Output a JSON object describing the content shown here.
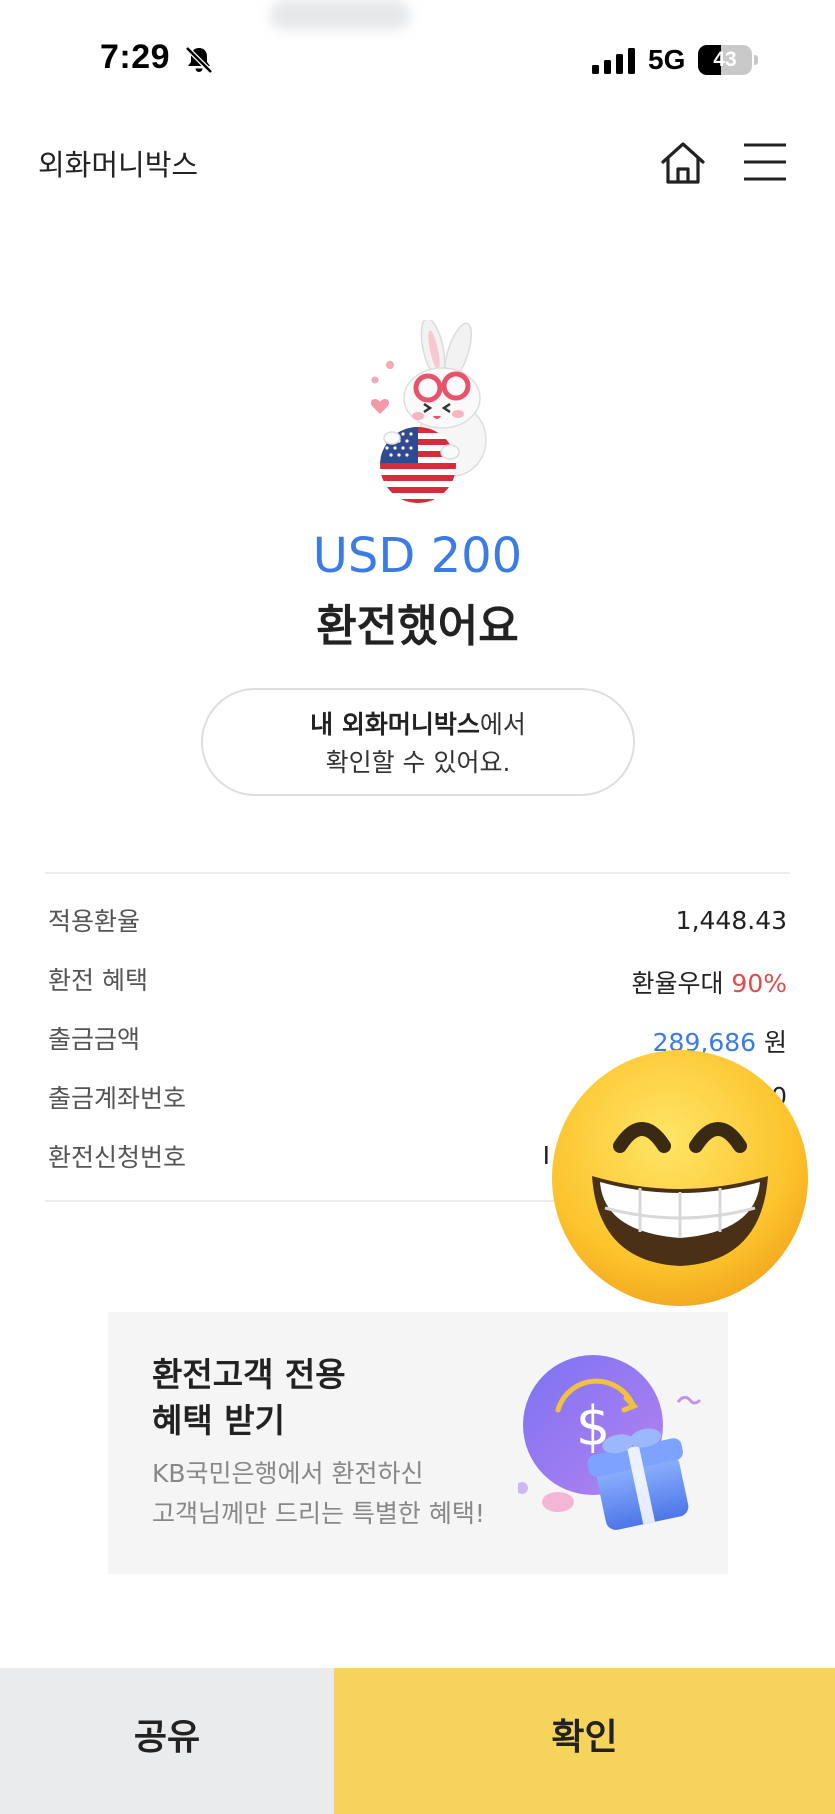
{
  "status_bar": {
    "time": "7:29",
    "network": "5G",
    "battery_percent": 43,
    "battery_label": "43",
    "icons": [
      "bell-slash-icon",
      "signal-bars-icon",
      "battery-icon"
    ]
  },
  "header": {
    "title": "외화머니박스",
    "icons": [
      "home-icon",
      "hamburger-menu-icon"
    ]
  },
  "hero": {
    "amount": "USD 200",
    "message": "환전했어요",
    "pill_bold": "내 외화머니박스",
    "pill_rest": "에서",
    "pill_line2": "확인할 수 있어요."
  },
  "details": {
    "rate_label": "적용환율",
    "rate_value": "1,448.43",
    "benefit_label": "환전 혜택",
    "benefit_prefix": "환율우대 ",
    "benefit_percent": "90%",
    "withdraw_label": "출금금액",
    "withdraw_amount": "289,686",
    "withdraw_unit": " 원",
    "account_label": "출금계좌번호",
    "account_value": "2",
    "account_value_tail": "0",
    "request_label": "환전신청번호",
    "request_value": "I"
  },
  "banner": {
    "title_line1": "환전고객 전용",
    "title_line2": "혜택 받기",
    "sub_line1": "KB국민은행에서 환전하신",
    "sub_line2": "고객님께만 드리는 특별한 혜택!",
    "art_symbol": "$"
  },
  "buttons": {
    "share": "공유",
    "confirm": "확인"
  },
  "colors": {
    "accent_blue": "#3b7be4",
    "accent_red": "#e24b4b",
    "confirm_yellow": "#f5d35c",
    "share_gray": "#eaebed"
  }
}
